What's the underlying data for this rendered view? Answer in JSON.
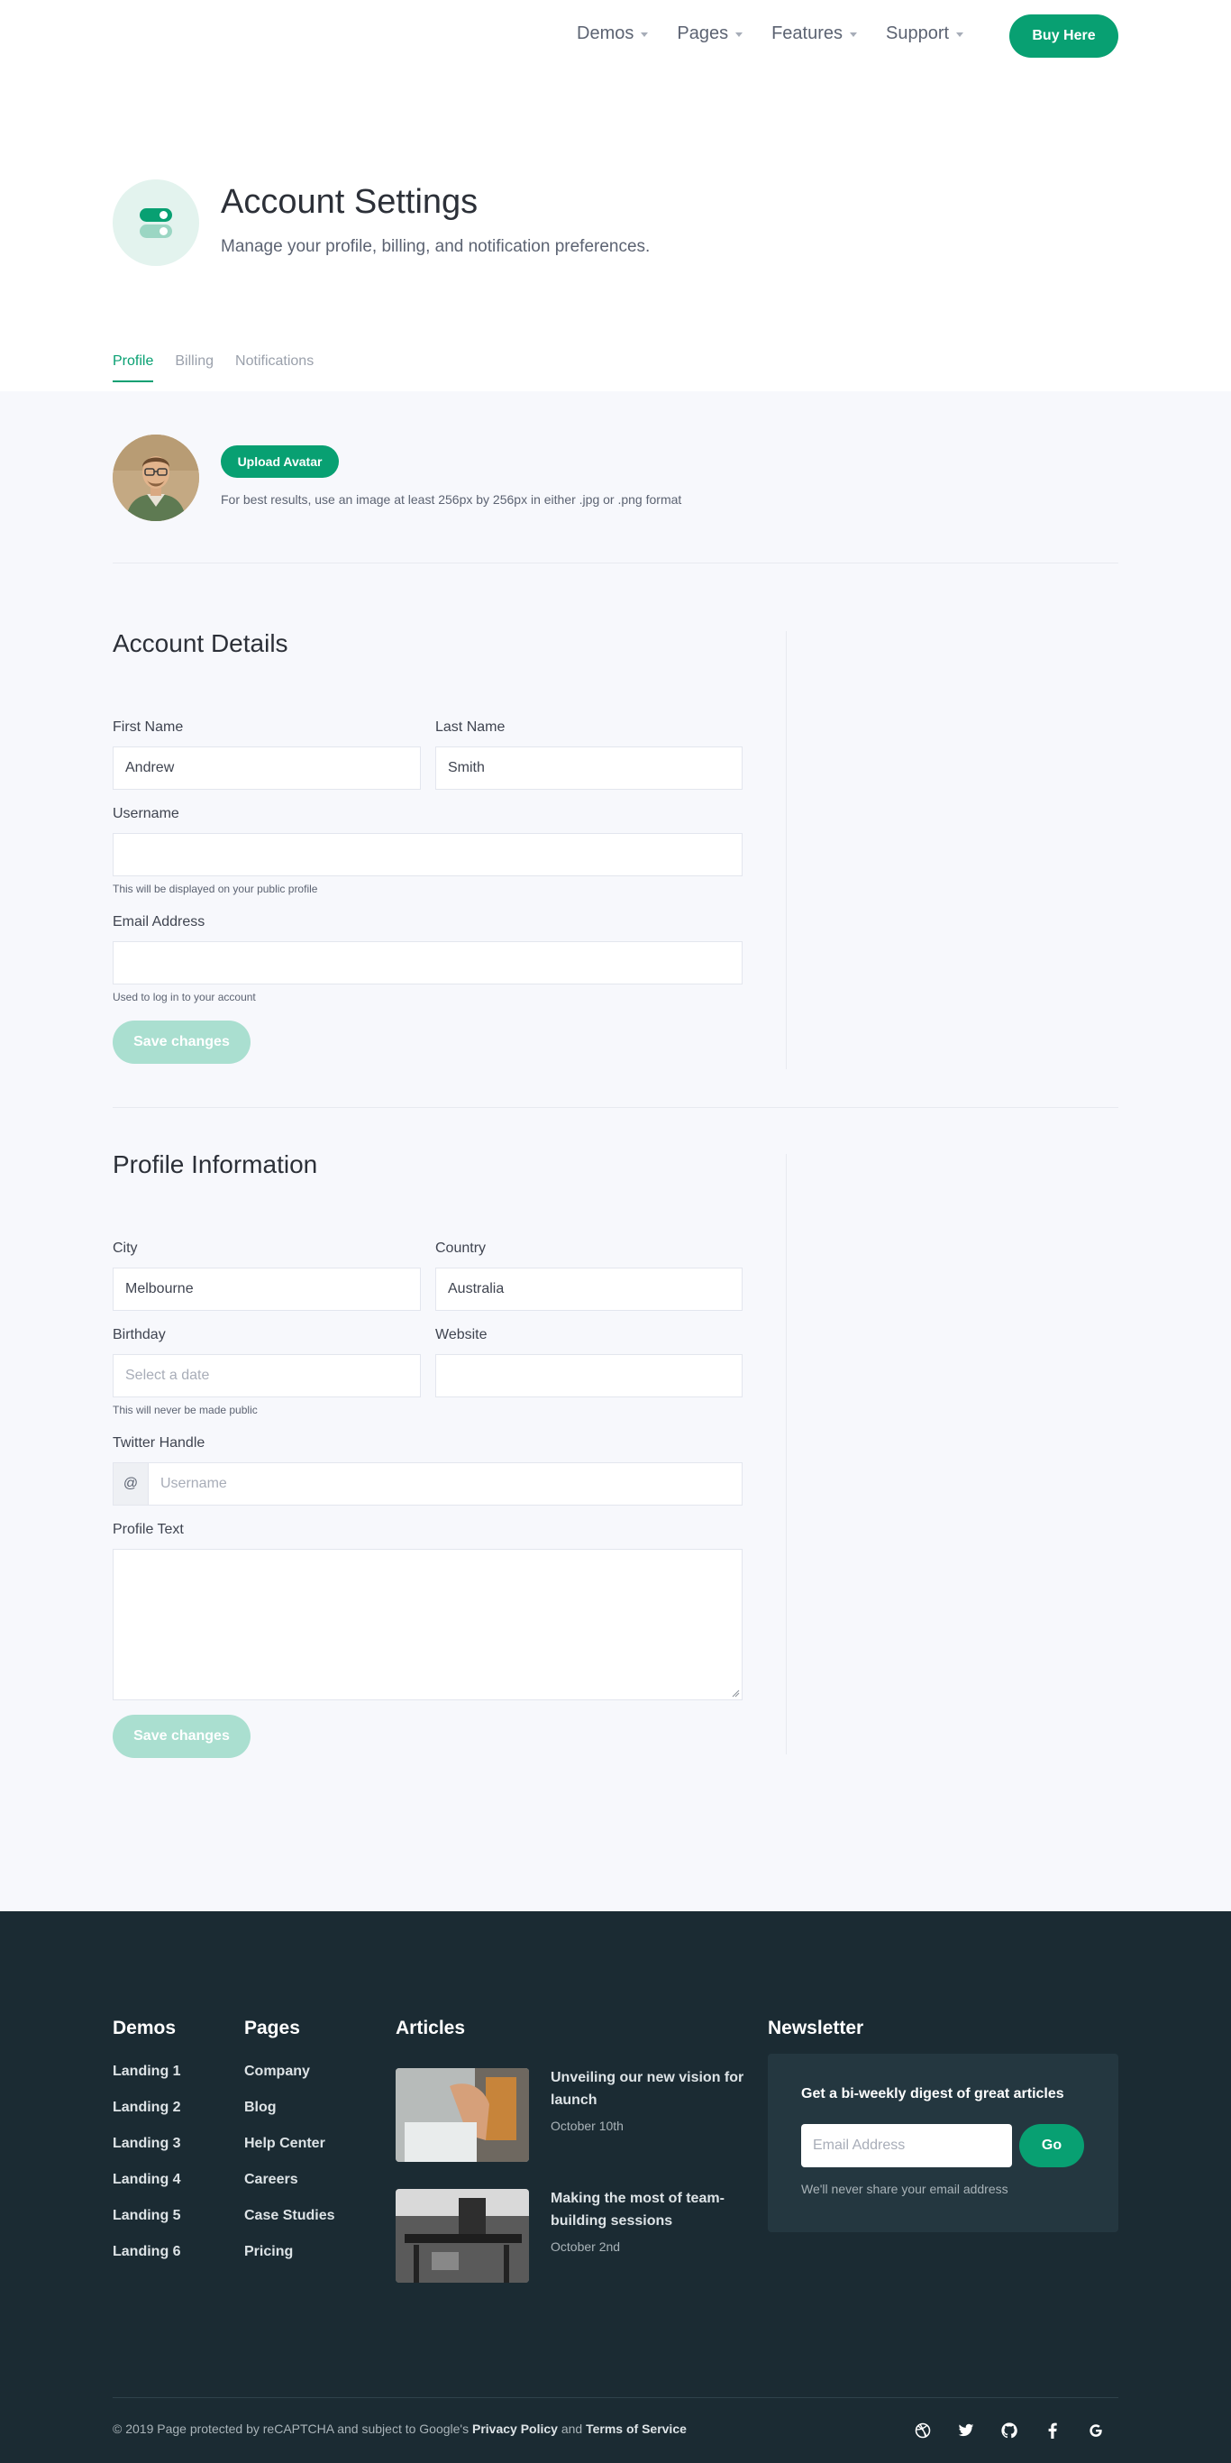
{
  "nav": {
    "items": [
      "Demos",
      "Pages",
      "Features",
      "Support"
    ],
    "buy_label": "Buy Here"
  },
  "header": {
    "title": "Account Settings",
    "subtitle": "Manage your profile, billing, and notification preferences.",
    "tabs": [
      "Profile",
      "Billing",
      "Notifications"
    ]
  },
  "avatar": {
    "upload_label": "Upload Avatar",
    "hint": "For best results, use an image at least 256px by 256px in either .jpg or .png format"
  },
  "account": {
    "title": "Account Details",
    "first_name_label": "First Name",
    "first_name_value": "Andrew",
    "last_name_label": "Last Name",
    "last_name_value": "Smith",
    "username_label": "Username",
    "username_value": "",
    "username_help": "This will be displayed on your public profile",
    "email_label": "Email Address",
    "email_value": "",
    "email_help": "Used to log in to your account",
    "save_label": "Save changes"
  },
  "profile": {
    "title": "Profile Information",
    "city_label": "City",
    "city_value": "Melbourne",
    "country_label": "Country",
    "country_value": "Australia",
    "birthday_label": "Birthday",
    "birthday_placeholder": "Select a date",
    "birthday_help": "This will never be made public",
    "website_label": "Website",
    "website_value": "",
    "twitter_label": "Twitter Handle",
    "twitter_prefix": "@",
    "twitter_placeholder": "Username",
    "profile_text_label": "Profile Text",
    "save_label": "Save changes"
  },
  "footer": {
    "demos_title": "Demos",
    "demos": [
      "Landing 1",
      "Landing 2",
      "Landing 3",
      "Landing 4",
      "Landing 5",
      "Landing 6"
    ],
    "pages_title": "Pages",
    "pages": [
      "Company",
      "Blog",
      "Help Center",
      "Careers",
      "Case Studies",
      "Pricing"
    ],
    "articles_title": "Articles",
    "articles": [
      {
        "title": "Unveiling our new vision for launch",
        "date": "October 10th"
      },
      {
        "title": "Making the most of team-building sessions",
        "date": "October 2nd"
      }
    ],
    "newsletter_title": "Newsletter",
    "newsletter_heading": "Get a bi-weekly digest of great articles",
    "newsletter_placeholder": "Email Address",
    "newsletter_button": "Go",
    "newsletter_note": "We'll never share your email address",
    "copyright_prefix": "© 2019 Page protected by reCAPTCHA and subject to Google's",
    "privacy": "Privacy Policy",
    "and": "and",
    "terms": "Terms of Service",
    "social_icons": [
      "dribbble-icon",
      "twitter-icon",
      "github-icon",
      "facebook-icon",
      "google-icon"
    ]
  },
  "colors": {
    "accent": "#08a072",
    "accent_light": "#aadfd0",
    "footer_bg": "#1b2b33",
    "main_bg": "#f7f8fc"
  }
}
